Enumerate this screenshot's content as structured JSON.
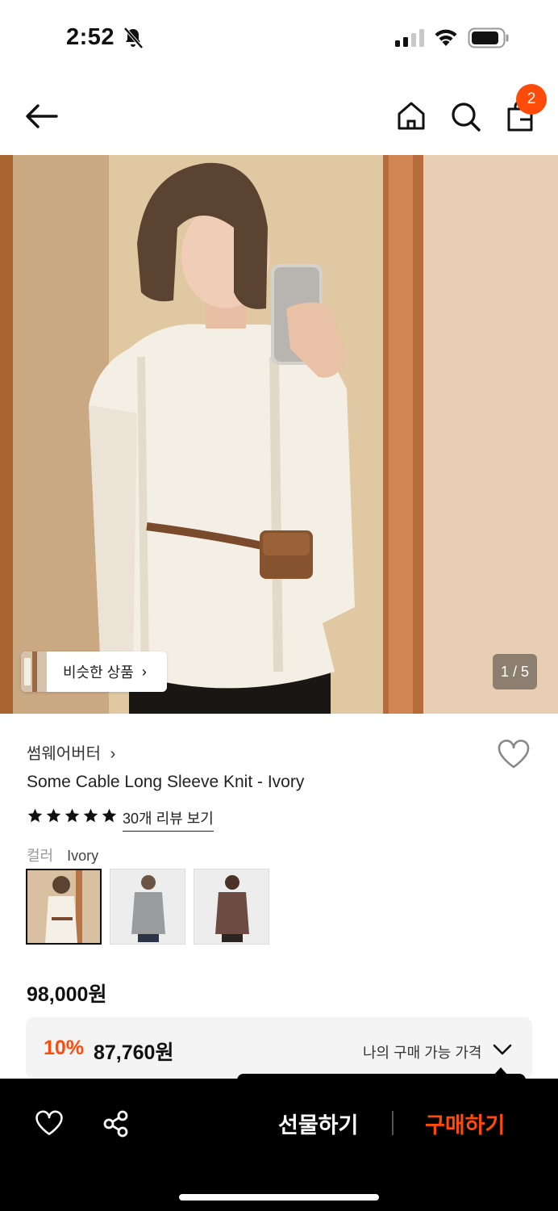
{
  "status": {
    "time": "2:52"
  },
  "nav": {
    "cart_count": "2",
    "icons": [
      "back-arrow-icon",
      "home-icon",
      "search-icon",
      "shopping-bag-icon"
    ]
  },
  "photo": {
    "similar_label": "비슷한 상품",
    "similar_chevron": "›",
    "counter": "1 / 5"
  },
  "product": {
    "brand": "썸웨어버터",
    "brand_chevron": "›",
    "title": "Some Cable Long Sleeve Knit - Ivory",
    "rating_stars": 5,
    "review_link": "30개 리뷰 보기",
    "color_label": "컬러",
    "color_value": "Ivory",
    "swatches": [
      "Ivory",
      "Gray",
      "Brown"
    ],
    "price": "98,000원",
    "discount_rate": "10%",
    "discount_price": "87,760원",
    "my_price_label": "나의 구매 가능 가격"
  },
  "bottom_bar": {
    "gift_label": "선물하기",
    "buy_label": "구매하기"
  },
  "colors": {
    "accent": "#ff4b0a",
    "bar_bg": "#000000"
  }
}
